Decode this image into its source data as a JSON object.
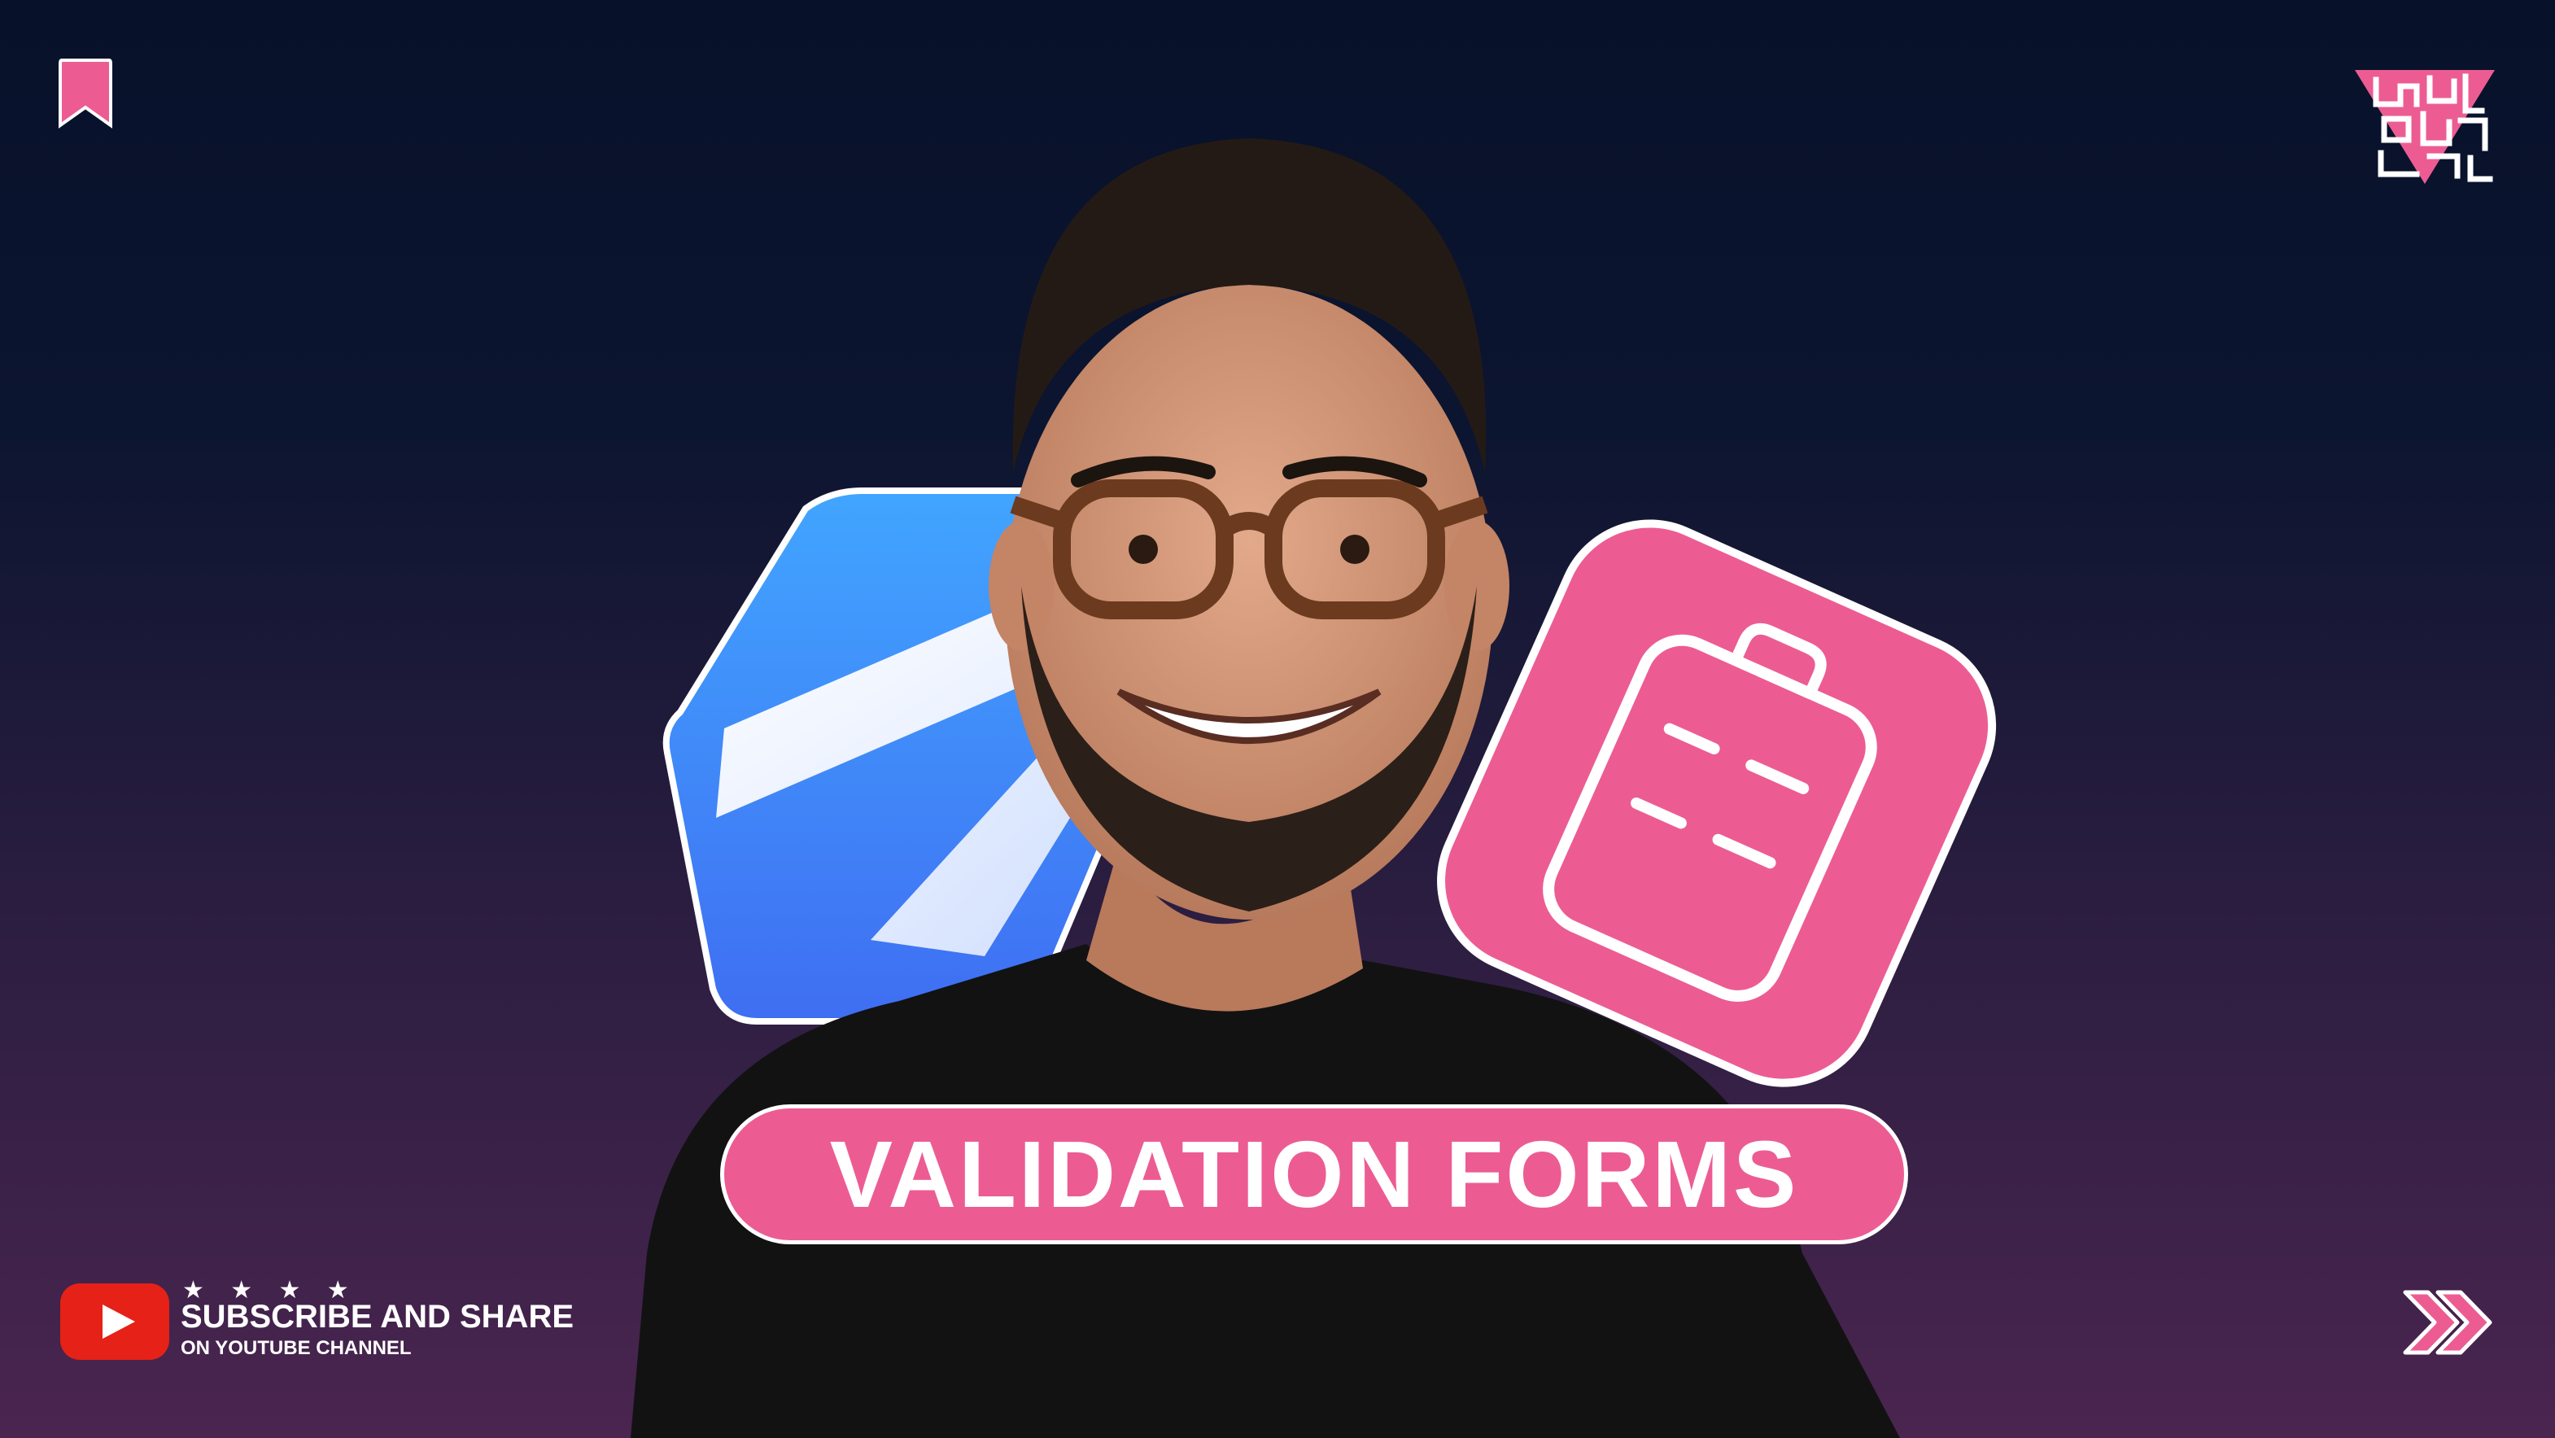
{
  "title": {
    "text": "VALIDATION FORMS"
  },
  "cta": {
    "stars": "★ ★ ★ ★",
    "main": "SUBSCRIBE AND SHARE",
    "sub": "ON YOUTUBE CHANNEL"
  },
  "icons": {
    "corner_top_left": "bookmark-icon",
    "corner_top_right": "brand-logo",
    "left_badge": "zod-logo",
    "right_badge": "clipboard-icon",
    "bottom_left": "youtube-play-icon",
    "bottom_right": "chevron-double-right-icon"
  },
  "colors": {
    "accent_pink": "#ec5c93",
    "zod_blue": "#3a86f5",
    "youtube_red": "#e62117",
    "background_top": "#08112a",
    "background_bottom": "#4a2550"
  }
}
